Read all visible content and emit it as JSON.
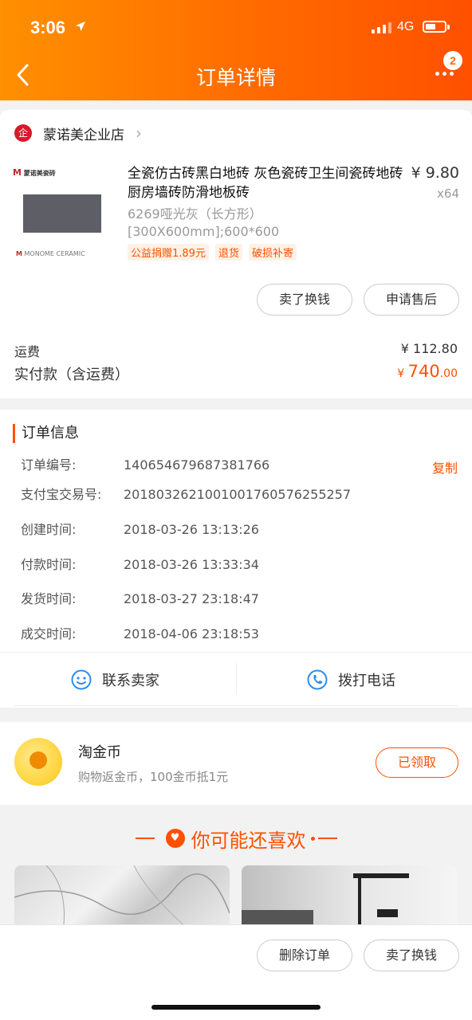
{
  "status_bar": {
    "time": "3:06",
    "network": "4G"
  },
  "header": {
    "title": "订单详情",
    "badge_count": "2",
    "back_icon": "chevron-left-icon",
    "more_icon": "more-dots-icon"
  },
  "shop": {
    "name": "蒙诺美企业店"
  },
  "product": {
    "image_brand_text": "蒙诺美瓷砖",
    "image_brand_sub": "MONOME CERAMIC",
    "title": "全瓷仿古砖黑白地砖 灰色瓷砖卫生间瓷砖地砖 厨房墙砖防滑地板砖",
    "price": "¥ 9.80",
    "quantity": "x64",
    "spec": "6269哑光灰（长方形）[300X600mm];600*600",
    "tags": [
      "公益捐赠1.89元",
      "退货",
      "破损补寄"
    ]
  },
  "product_actions": {
    "sell_label": "卖了换钱",
    "after_sale_label": "申请售后"
  },
  "payment": {
    "shipping_label": "运费",
    "shipping_value": "¥ 112.80",
    "paid_label": "实付款（含运费）",
    "paid_currency": "¥",
    "paid_int": "740",
    "paid_dec": ".00"
  },
  "order_info": {
    "heading": "订单信息",
    "copy_label": "复制",
    "rows": [
      {
        "key": "订单编号:",
        "value": "140654679687381766"
      },
      {
        "key": "支付宝交易号:",
        "value": "2018032621001001760576255257"
      },
      {
        "key": "创建时间:",
        "value": "2018-03-26 13:13:26"
      },
      {
        "key": "付款时间:",
        "value": "2018-03-26 13:33:34"
      },
      {
        "key": "发货时间:",
        "value": "2018-03-27 23:18:47"
      },
      {
        "key": "成交时间:",
        "value": "2018-04-06 23:18:53"
      }
    ],
    "contact_seller": "联系卖家",
    "call_phone": "拨打电话"
  },
  "coins": {
    "title": "淘金币",
    "subtitle": "购物返金币，100金币抵1元",
    "button": "已领取"
  },
  "recommend": {
    "title": "你可能还喜欢"
  },
  "bottom_actions": {
    "delete_label": "删除订单",
    "sell_label": "卖了换钱"
  },
  "colors": {
    "accent": "#ff5000",
    "header_start": "#ff9000",
    "header_end": "#ff5000"
  }
}
